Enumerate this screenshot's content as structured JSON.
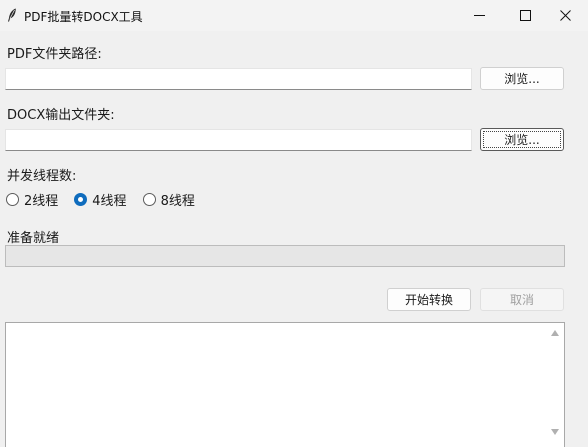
{
  "window": {
    "title": "PDF批量转DOCX工具",
    "icon": "feather-icon"
  },
  "pdf_folder": {
    "label": "PDF文件夹路径:",
    "value": "",
    "browse_label": "浏览..."
  },
  "docx_folder": {
    "label": "DOCX输出文件夹:",
    "value": "",
    "browse_label": "浏览..."
  },
  "threads": {
    "label": "并发线程数:",
    "options": [
      {
        "label": "2线程",
        "checked": false
      },
      {
        "label": "4线程",
        "checked": true
      },
      {
        "label": "8线程",
        "checked": false
      }
    ]
  },
  "status": {
    "text": "准备就绪",
    "progress": 0
  },
  "actions": {
    "start_label": "开始转换",
    "cancel_label": "取消"
  },
  "log": {
    "text": ""
  },
  "colors": {
    "accent": "#0f6cbd",
    "background": "#f0f0f0"
  }
}
